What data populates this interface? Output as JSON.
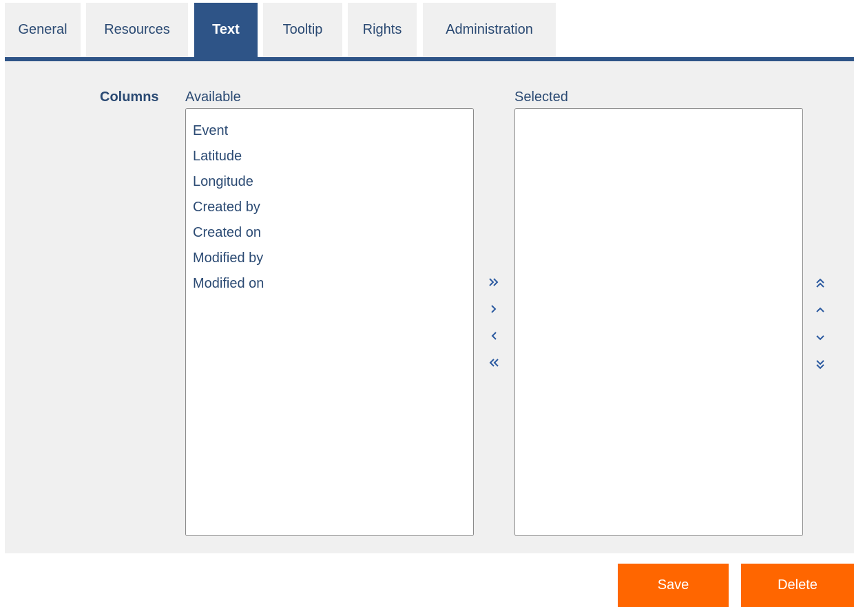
{
  "tabs": [
    {
      "label": "General"
    },
    {
      "label": "Resources"
    },
    {
      "label": "Text"
    },
    {
      "label": "Tooltip"
    },
    {
      "label": "Rights"
    },
    {
      "label": "Administration"
    }
  ],
  "active_tab": "Text",
  "form": {
    "field_label": "Columns",
    "available": {
      "caption": "Available",
      "items": [
        "Event",
        "Latitude",
        "Longitude",
        "Created by",
        "Created on",
        "Modified by",
        "Modified on"
      ]
    },
    "selected": {
      "caption": "Selected",
      "items": []
    }
  },
  "transfer_icons": [
    "double-chevron-right-icon",
    "chevron-right-icon",
    "chevron-left-icon",
    "double-chevron-left-icon"
  ],
  "order_icons": [
    "double-chevron-up-icon",
    "chevron-up-icon",
    "chevron-down-icon",
    "double-chevron-down-icon"
  ],
  "buttons": {
    "save": "Save",
    "delete": "Delete"
  },
  "colors": {
    "accent": "#2e5487",
    "action": "#ff6600",
    "panel": "#f0f0f0",
    "text": "#2b4a73"
  }
}
